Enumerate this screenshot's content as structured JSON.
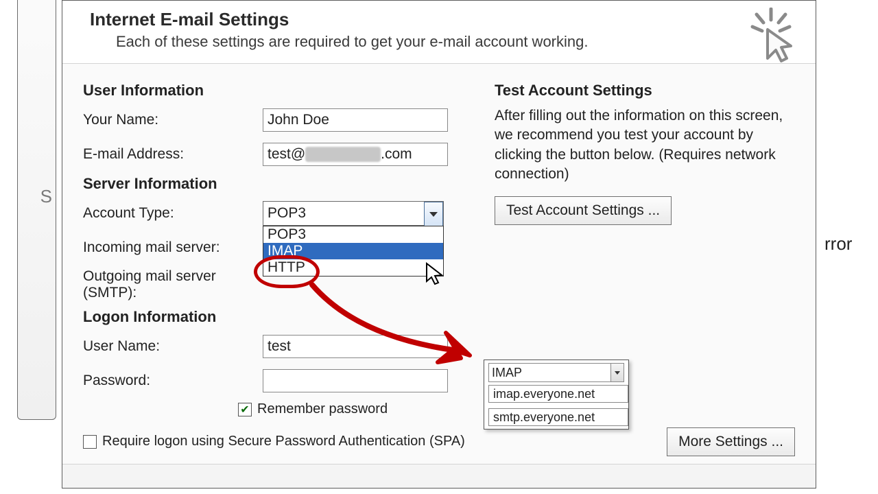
{
  "header": {
    "title": "Internet E-mail Settings",
    "subtitle": "Each of these settings are required to get your e-mail account working."
  },
  "user_info": {
    "section": "User Information",
    "name_label": "Your Name:",
    "name_value": "John Doe",
    "email_label": "E-mail Address:",
    "email_prefix": "test@",
    "email_suffix": ".com"
  },
  "server_info": {
    "section": "Server Information",
    "type_label": "Account Type:",
    "type_value": "POP3",
    "type_options": [
      "POP3",
      "IMAP",
      "HTTP"
    ],
    "incoming_label": "Incoming mail server:",
    "outgoing_label": "Outgoing mail server (SMTP):"
  },
  "logon": {
    "section": "Logon Information",
    "user_label": "User Name:",
    "user_value": "test",
    "pass_label": "Password:",
    "remember_label": "Remember password",
    "spa_label": "Require logon using Secure Password Authentication (SPA)"
  },
  "test": {
    "section": "Test Account Settings",
    "text": "After filling out the information on this screen, we recommend you test your account by clicking the button below. (Requires network connection)",
    "button": "Test Account Settings ..."
  },
  "footer": {
    "more": "More Settings ..."
  },
  "inset": {
    "type": "IMAP",
    "incoming": "imap.everyone.net",
    "outgoing": "smtp.everyone.net"
  },
  "bg": {
    "stray_s": "S",
    "stray_err": "rror"
  }
}
